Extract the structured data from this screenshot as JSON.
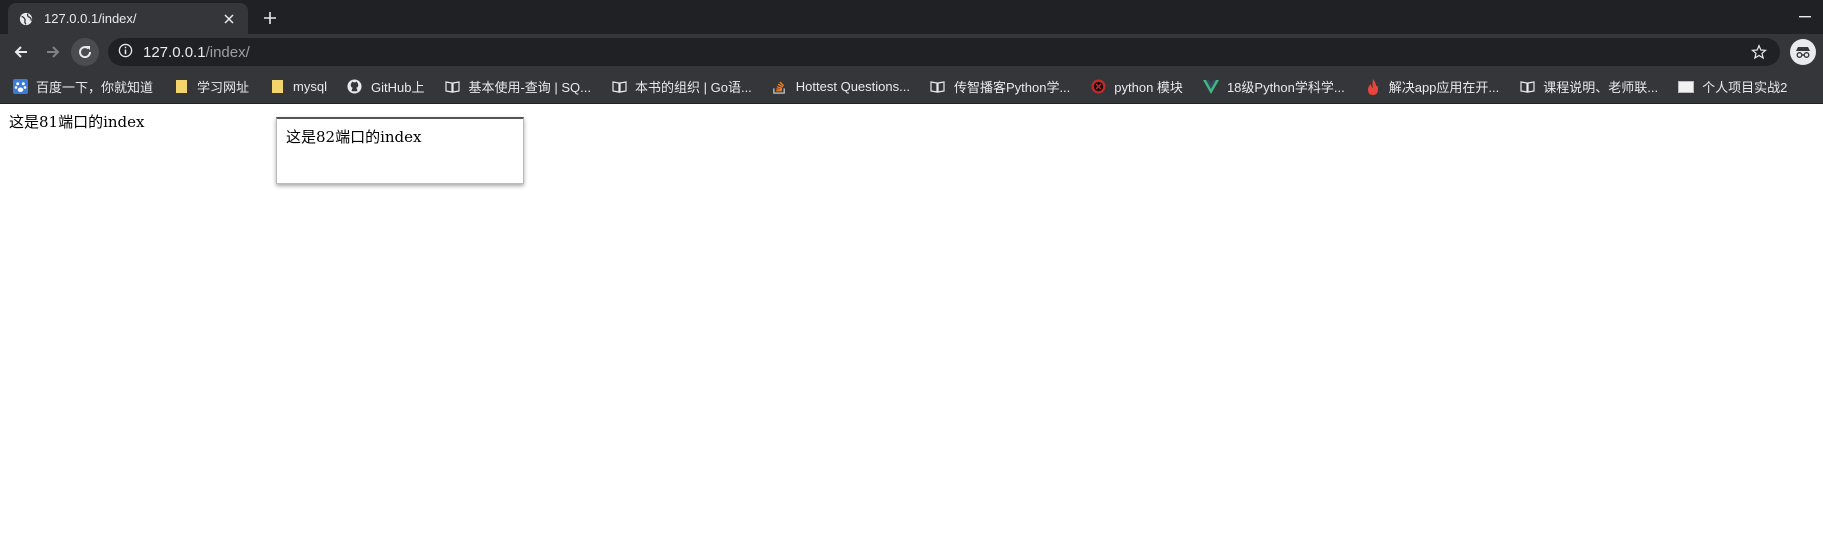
{
  "tab": {
    "title": "127.0.0.1/index/"
  },
  "address_bar": {
    "host": "127.0.0.1",
    "path": "/index/"
  },
  "bookmarks": [
    {
      "label": "百度一下，你就知道",
      "icon": "baidu-icon"
    },
    {
      "label": "学习网址",
      "icon": "folder-icon"
    },
    {
      "label": "mysql",
      "icon": "folder-icon"
    },
    {
      "label": "GitHub上",
      "icon": "github-icon"
    },
    {
      "label": "基本使用-查询 | SQ...",
      "icon": "book-icon"
    },
    {
      "label": "本书的组织 | Go语...",
      "icon": "book-icon"
    },
    {
      "label": "Hottest Questions...",
      "icon": "stackoverflow-icon"
    },
    {
      "label": "传智播客Python学...",
      "icon": "book-icon"
    },
    {
      "label": "python 模块",
      "icon": "python-icon"
    },
    {
      "label": "18级Python学科学...",
      "icon": "vue-icon"
    },
    {
      "label": "解决app应用在开...",
      "icon": "flame-icon"
    },
    {
      "label": "课程说明、老师联...",
      "icon": "book-icon"
    },
    {
      "label": "个人项目实战2",
      "icon": "page-icon"
    }
  ],
  "page": {
    "main_text": "这是81端口的index",
    "iframe_text": "这是82端口的index"
  },
  "colors": {
    "tab_strip": "#202124",
    "toolbar": "#35363a",
    "omnibox": "#202124",
    "text_light": "#e8eaed",
    "text_dim": "#9aa0a6"
  }
}
